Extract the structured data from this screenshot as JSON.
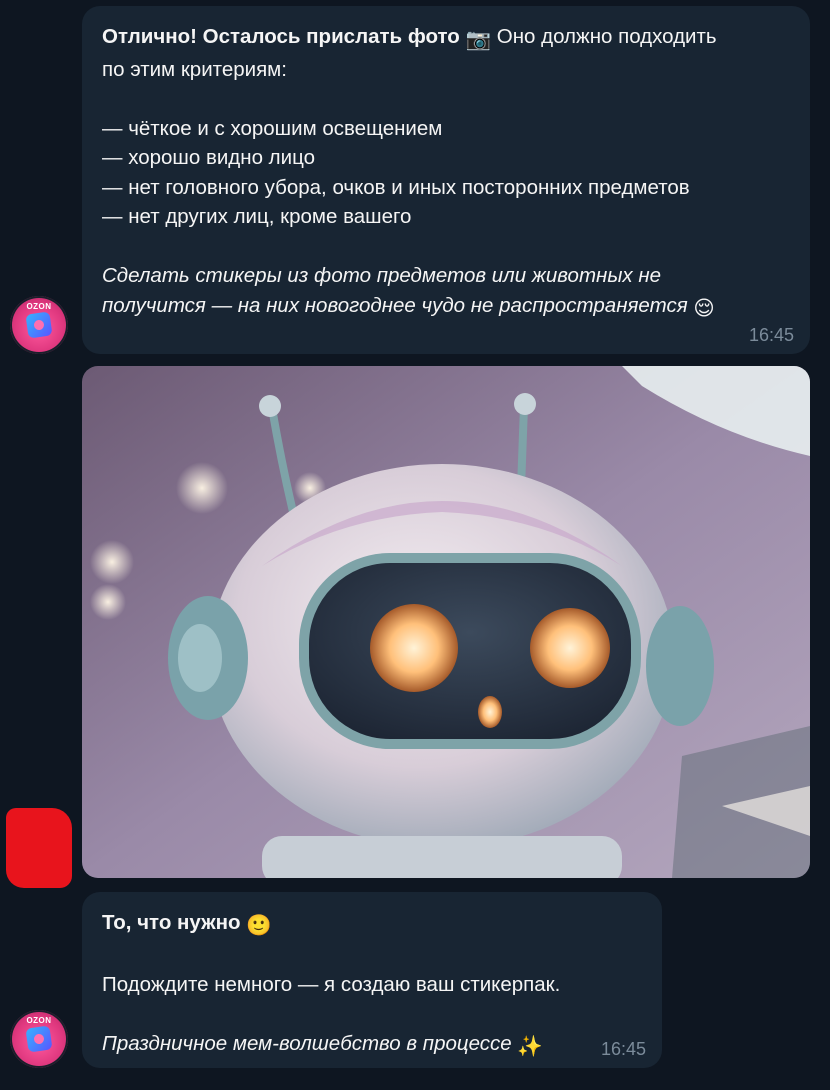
{
  "chat": {
    "message1": {
      "lead_bold": "Отлично! Осталось прислать фото",
      "camera_emoji": "📷",
      "lead_rest": " Оно должно подходить",
      "lead_line2": "по этим критериям:",
      "criteria": [
        " — чёткое и с хорошим освещением",
        " — хорошо видно лицо",
        " — нет головного убора, очков и иных посторонних предметов",
        " — нет других лиц, кроме вашего"
      ],
      "note_line1": "Сделать стикеры из фото предметов или животных не",
      "note_line2": "получится — на них новогоднее чудо не распространяется",
      "note_emoji": "😌",
      "time": "16:45"
    },
    "photo": {
      "alt": "Фото робота"
    },
    "message3": {
      "title": "То, что нужно",
      "title_emoji": "🙂",
      "line": "Подождите немного — я создаю ваш стикерпак.",
      "italic": "Праздничное мем-волшебство в процессе",
      "italic_emoji": "✨",
      "time": "16:45"
    },
    "avatar": {
      "brand": "OZON"
    }
  },
  "colors": {
    "background": "#0e1621",
    "bubble": "#182533",
    "time": "#7b8b9a",
    "avatar": "#e0387f",
    "redaction": "#e8141c"
  }
}
